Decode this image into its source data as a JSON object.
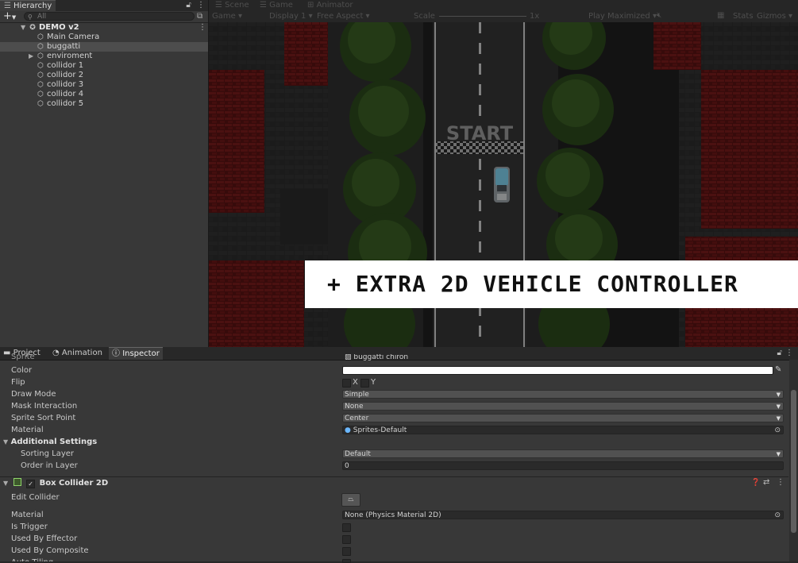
{
  "hierarchy": {
    "tab_label": "Hierarchy",
    "search_placeholder": "All",
    "scene_name": "DEMO v2",
    "items": [
      {
        "label": "Main Camera"
      },
      {
        "label": "buggatti"
      },
      {
        "label": "enviroment"
      },
      {
        "label": "collidor 1"
      },
      {
        "label": "collidor 2"
      },
      {
        "label": "collidor 3"
      },
      {
        "label": "collidor 4"
      },
      {
        "label": "collidor 5"
      }
    ]
  },
  "scene_tabs": {
    "scene": "Scene",
    "game": "Game",
    "animator": "Animator",
    "game_mode": "Game",
    "display": "Display 1",
    "aspect": "Free Aspect",
    "scale_label": "Scale",
    "scale_value": "1x",
    "play_mode": "Play Maximized",
    "stats": "Stats",
    "gizmos": "Gizmos"
  },
  "game_view": {
    "start_text": "START",
    "banner_text": "+ EXTRA 2D VEHICLE CONTROLLER"
  },
  "bottom_tabs": {
    "project": "Project",
    "animation": "Animation",
    "inspector": "Inspector"
  },
  "inspector": {
    "sprite_label": "Sprite",
    "sprite_value": "buggatti chiron",
    "color_label": "Color",
    "flip_label": "Flip",
    "flip_x": "X",
    "flip_y": "Y",
    "draw_mode_label": "Draw Mode",
    "draw_mode_value": "Simple",
    "mask_label": "Mask Interaction",
    "mask_value": "None",
    "sort_point_label": "Sprite Sort Point",
    "sort_point_value": "Center",
    "material_label": "Material",
    "material_value": "Sprites-Default",
    "additional_settings": "Additional Settings",
    "sorting_layer_label": "Sorting Layer",
    "sorting_layer_value": "Default",
    "order_label": "Order in Layer",
    "order_value": "0",
    "box_collider_title": "Box Collider 2D",
    "edit_collider_label": "Edit Collider",
    "bc_material_label": "Material",
    "bc_material_value": "None (Physics Material 2D)",
    "is_trigger_label": "Is Trigger",
    "used_by_effector_label": "Used By Effector",
    "used_by_composite_label": "Used By Composite",
    "auto_tiling_label": "Auto Tiling"
  },
  "colors": {
    "panel_bg": "#383838",
    "road": "#3a3a3a",
    "grass": "#2e4a1e",
    "brick": "#7a1a1a",
    "car": "#7fd0ee"
  }
}
